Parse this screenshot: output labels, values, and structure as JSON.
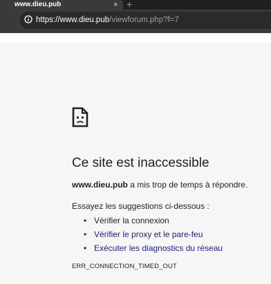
{
  "browser": {
    "tab": {
      "title": "www.dieu.pub",
      "close_glyph": "×"
    },
    "new_tab_glyph": "+",
    "omnibox": {
      "icon": "info-icon",
      "url_host": "https://www.dieu.pub",
      "url_path": "/viewforum.php?f=7"
    }
  },
  "error_page": {
    "icon": "sad-document-icon",
    "title": "Ce site est inaccessible",
    "description": {
      "host": "www.dieu.pub",
      "text": " a mis trop de temps à répondre."
    },
    "suggestions_heading": "Essayez les suggestions ci-dessous :",
    "suggestions": [
      {
        "label": "Vérifier la connexion",
        "is_link": false
      },
      {
        "label": "Vérifier le proxy et le pare-feu",
        "is_link": true
      },
      {
        "label": "Exécuter les diagnostics du réseau",
        "is_link": true
      }
    ],
    "error_code": "ERR_CONNECTION_TIMED_OUT"
  },
  "colors": {
    "page_background": "#f6f6f6",
    "link": "#1a237e",
    "text": "#202124",
    "chrome_dark": "#3a3a3a"
  }
}
